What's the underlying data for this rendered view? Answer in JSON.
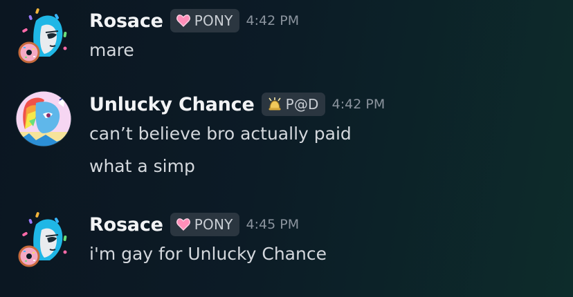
{
  "messages": [
    {
      "author": "Rosace",
      "tag": {
        "label": "PONY",
        "icon": "heart-icon",
        "color": "#ff8fb9"
      },
      "time": "4:42 PM",
      "lines": [
        "mare"
      ]
    },
    {
      "author": "Unlucky Chance",
      "tag": {
        "label": "P@D",
        "icon": "bell-icon",
        "color": "#f0c85a"
      },
      "time": "4:42 PM",
      "lines": [
        "can’t believe bro actually paid",
        "what a simp"
      ]
    },
    {
      "author": "Rosace",
      "tag": {
        "label": "PONY",
        "icon": "heart-icon",
        "color": "#ff8fb9"
      },
      "time": "4:45 PM",
      "lines": [
        "i'm gay for Unlucky Chance"
      ]
    }
  ],
  "colors": {
    "background": "#0c1b26",
    "username": "#f2f3f5",
    "message_text": "#d4d8dd",
    "timestamp": "#8b949e",
    "tag_background": "#2b3640"
  }
}
